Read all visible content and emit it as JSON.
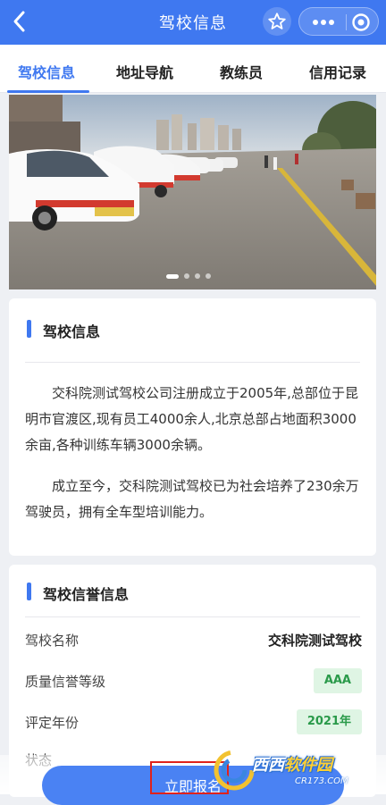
{
  "nav": {
    "title": "驾校信息"
  },
  "tabs": [
    {
      "label": "驾校信息",
      "active": true
    },
    {
      "label": "地址导航",
      "active": false
    },
    {
      "label": "教练员",
      "active": false
    },
    {
      "label": "信用记录",
      "active": false
    }
  ],
  "banner": {
    "slide_count": 4,
    "active_slide": 1
  },
  "intro_card": {
    "title": "驾校信息",
    "paragraphs": [
      "交科院测试驾校公司注册成立于2005年,总部位于昆明市官渡区,现有员工4000余人,北京总部占地面积3000余亩,各种训练车辆3000余辆。",
      "成立至今，交科院测试驾校已为社会培养了230余万驾驶员，拥有全车型培训能力。"
    ]
  },
  "reputation_card": {
    "title": "驾校信誉信息",
    "rows": [
      {
        "label": "驾校名称",
        "value": "交科院测试驾校"
      },
      {
        "label": "质量信誉等级",
        "value": "AAA"
      },
      {
        "label": "评定年份",
        "value": "2021年"
      },
      {
        "label": "状态",
        "value": ""
      }
    ]
  },
  "footer": {
    "enroll_label": "立即报名"
  },
  "watermark": {
    "main_a": "西西",
    "main_b": "软件园",
    "sub": "CR173.COM"
  },
  "colors": {
    "primary": "#3f78f0",
    "badge_bg": "#dff5e4",
    "badge_text": "#2a9a4a",
    "highlight_box": "#e0221b"
  },
  "icons": {
    "back": "chevron-left-icon",
    "star": "star-icon",
    "more": "more-dots-icon",
    "close": "target-circle-icon"
  }
}
